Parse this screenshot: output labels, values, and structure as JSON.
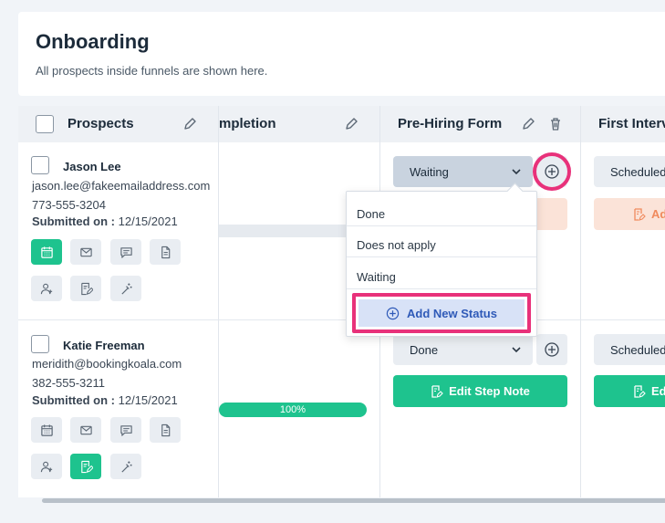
{
  "header": {
    "title": "Onboarding",
    "subtitle": "All prospects inside funnels are shown here."
  },
  "columns": {
    "prospects": "Prospects",
    "completion": "mpletion",
    "prehiring": "Pre-Hiring Form",
    "firstinterview": "First Interv"
  },
  "prospects": [
    {
      "name": "Jason Lee",
      "email": "jason.lee@fakeemailaddress.com",
      "phone": "773-555-3204",
      "submitted_label": "Submitted on :",
      "submitted_date": "12/15/2021",
      "prehiring_status": "Waiting",
      "interview_status": "Scheduled",
      "interview_note": "Ad"
    },
    {
      "name": "Katie Freeman",
      "email": "meridith@bookingkoala.com",
      "phone": "382-555-3211",
      "submitted_label": "Submitted on :",
      "submitted_date": "12/15/2021",
      "progress_label": "100%",
      "progress": 1.0,
      "prehiring_status": "Done",
      "prehiring_note": "Edit Step Note",
      "interview_status": "Scheduled",
      "interview_note": "Ed"
    }
  ],
  "dropdown": {
    "options": [
      "Done",
      "Does not apply",
      "Waiting"
    ],
    "add_label": "Add New Status"
  },
  "colors": {
    "accent_green": "#1ec38e",
    "highlight_pink": "#e8317a",
    "add_status_blue": "#2f5ab8"
  }
}
